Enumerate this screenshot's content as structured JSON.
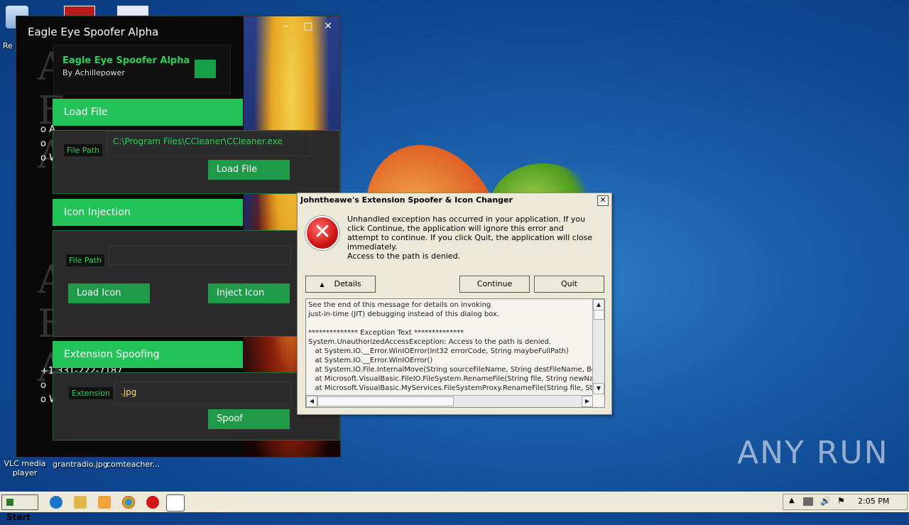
{
  "desktop": {
    "icons": [
      {
        "label": "Re"
      },
      {
        "label": "VLC media player"
      },
      {
        "label": "grantradio.jpg"
      },
      {
        "label": "comteacher..."
      }
    ],
    "watermark": "ANY RUN"
  },
  "spoofer": {
    "title": "Eagle Eye Spoofer Alpha",
    "header_title": "Eagle Eye Spoofer Alpha",
    "header_sub": "By Achillepower",
    "sections": {
      "load_file": "Load File",
      "icon_injection": "Icon Injection",
      "extension_spoofing": "Extension Spoofing"
    },
    "file_path_label": "File Path",
    "file_path_value": "C:\\Program Files\\CCleaner\\CCleaner.exe",
    "load_file_button": "Load File",
    "icon_path_label": "File Path",
    "icon_path_value": "",
    "load_icon_button": "Load Icon",
    "inject_icon_button": "Inject Icon",
    "extension_label": "Extension",
    "extension_value": ".jpg",
    "spoof_button": "Spoof",
    "bg_letters": [
      "A",
      "F",
      "A",
      "A",
      "F",
      "A"
    ],
    "bullets": [
      "o A",
      "o",
      "o W",
      "o",
      "o W"
    ],
    "phone": "+1 331-222-7187"
  },
  "dialog": {
    "title": "Johntheawe's Extension Spoofer & Icon Changer",
    "message": "Unhandled exception has occurred in your application. If you click Continue, the application will ignore this error and attempt to continue. If you click Quit, the application will close immediately.",
    "message2": "Access to the path is denied.",
    "details_button": "Details",
    "continue_button": "Continue",
    "quit_button": "Quit",
    "details_text": "See the end of this message for details on invoking\njust-in-time (JIT) debugging instead of this dialog box.\n\n************** Exception Text **************\nSystem.UnauthorizedAccessException: Access to the path is denied.\n   at System.IO.__Error.WinIOError(Int32 errorCode, String maybeFullPath)\n   at System.IO.__Error.WinIOError()\n   at System.IO.File.InternalMove(String sourceFileName, String destFileName, Boolea\n   at Microsoft.VisualBasic.FileIO.FileSystem.RenameFile(String file, String newName)\n   at Microsoft.VisualBasic.MyServices.FileSystemProxy.RenameFile(String file, String"
  },
  "taskbar": {
    "start_label": "Start",
    "clock": "2:05 PM"
  },
  "colors": {
    "accent_green": "#22c45a",
    "dark_panel": "#2b2b2b",
    "dialog_bg": "#ece9d8"
  }
}
